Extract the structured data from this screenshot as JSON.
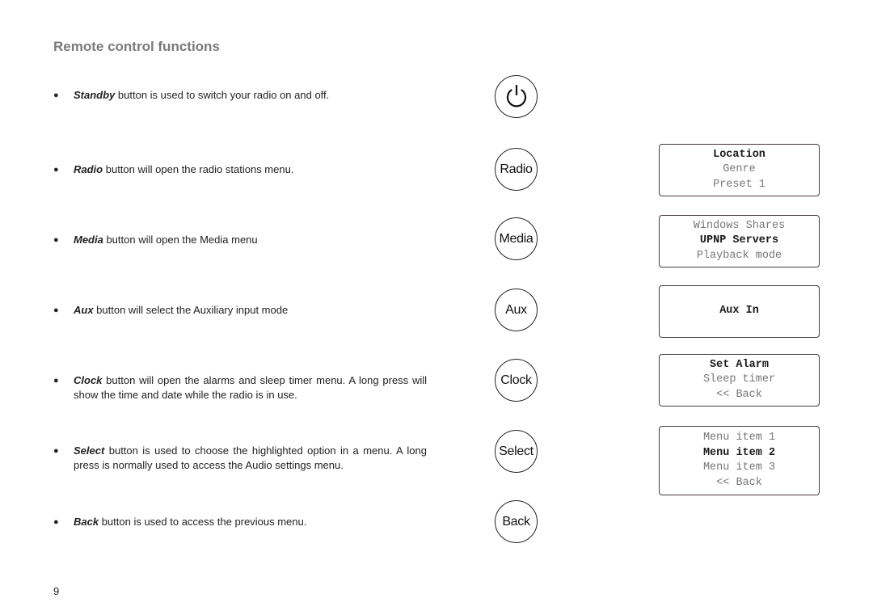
{
  "page": {
    "title": "Remote control functions",
    "page_number": "9"
  },
  "items": [
    {
      "keyword": "Standby",
      "text": " button is used to switch your radio on and off."
    },
    {
      "keyword": "Radio",
      "text": " button will open the radio stations menu."
    },
    {
      "keyword": "Media",
      "text": " button will open the Media menu"
    },
    {
      "keyword": "Aux",
      "text": " button will select the Auxiliary input mode"
    },
    {
      "keyword": "Clock",
      "text": " button will open the alarms and sleep timer menu. A long press will show the time and date while the radio is in use."
    },
    {
      "keyword": "Select",
      "text": " button is used to choose the highlighted option in a menu. A long press is normally used to access the Audio settings menu."
    },
    {
      "keyword": "Back",
      "text": " button is used to access the previous menu."
    }
  ],
  "buttons": [
    {
      "label": "",
      "icon": "power-icon"
    },
    {
      "label": "Radio"
    },
    {
      "label": "Media"
    },
    {
      "label": "Aux"
    },
    {
      "label": "Clock"
    },
    {
      "label": "Select"
    },
    {
      "label": "Back"
    }
  ],
  "displays": {
    "radio": {
      "lines": [
        "Location",
        "Genre",
        "Preset 1"
      ],
      "selected": "Location"
    },
    "media": {
      "lines": [
        "Windows Shares",
        "UPNP Servers",
        "Playback mode"
      ],
      "selected": "UPNP Servers"
    },
    "aux": {
      "lines": [
        "Aux In"
      ],
      "selected": "Aux In"
    },
    "clock": {
      "lines": [
        "Set Alarm",
        "Sleep timer",
        "<< Back"
      ],
      "selected": "Set Alarm"
    },
    "select": {
      "lines": [
        "Menu item 1",
        "Menu item 2",
        "Menu item 3",
        "<< Back"
      ],
      "selected": "Menu item 2"
    }
  }
}
